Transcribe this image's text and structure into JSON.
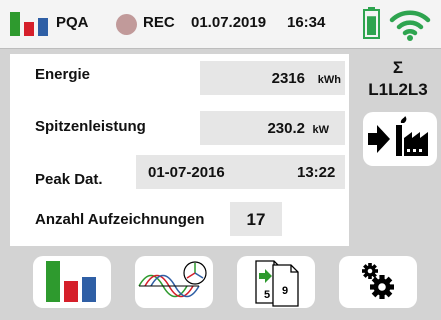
{
  "status": {
    "mode": "PQA",
    "rec": "REC",
    "date": "01.07.2019",
    "time": "16:34",
    "battery_level": 0.75
  },
  "panel": {
    "energy": {
      "label": "Energie",
      "value": "2316",
      "unit": "kWh"
    },
    "peak_power": {
      "label": "Spitzenleistung",
      "value": "230.2",
      "unit": "kW"
    },
    "peak_date": {
      "label": "Peak Dat.",
      "date": "01-07-2016",
      "time": "13:22"
    },
    "records": {
      "label": "Anzahl Aufzeichnungen",
      "value": "17"
    }
  },
  "right_col": {
    "sigma": "Σ",
    "phases": "L1L2L3"
  },
  "toolbar": {
    "recordings_badges": [
      "5",
      "9"
    ]
  },
  "colors": {
    "green": "#2e9a2e",
    "red": "#d51f2a",
    "blue": "#2f5fa5",
    "background": "#d3d3d3"
  },
  "icons": {
    "status_logo": "pqa-bars-icon",
    "battery": "battery-icon",
    "wifi": "wifi-icon",
    "export": "energy-to-factory-icon",
    "bar_chart": "bar-chart-icon",
    "waveform": "waveform-phasor-icon",
    "recordings": "recordings-pages-icon",
    "settings": "gears-icon"
  }
}
